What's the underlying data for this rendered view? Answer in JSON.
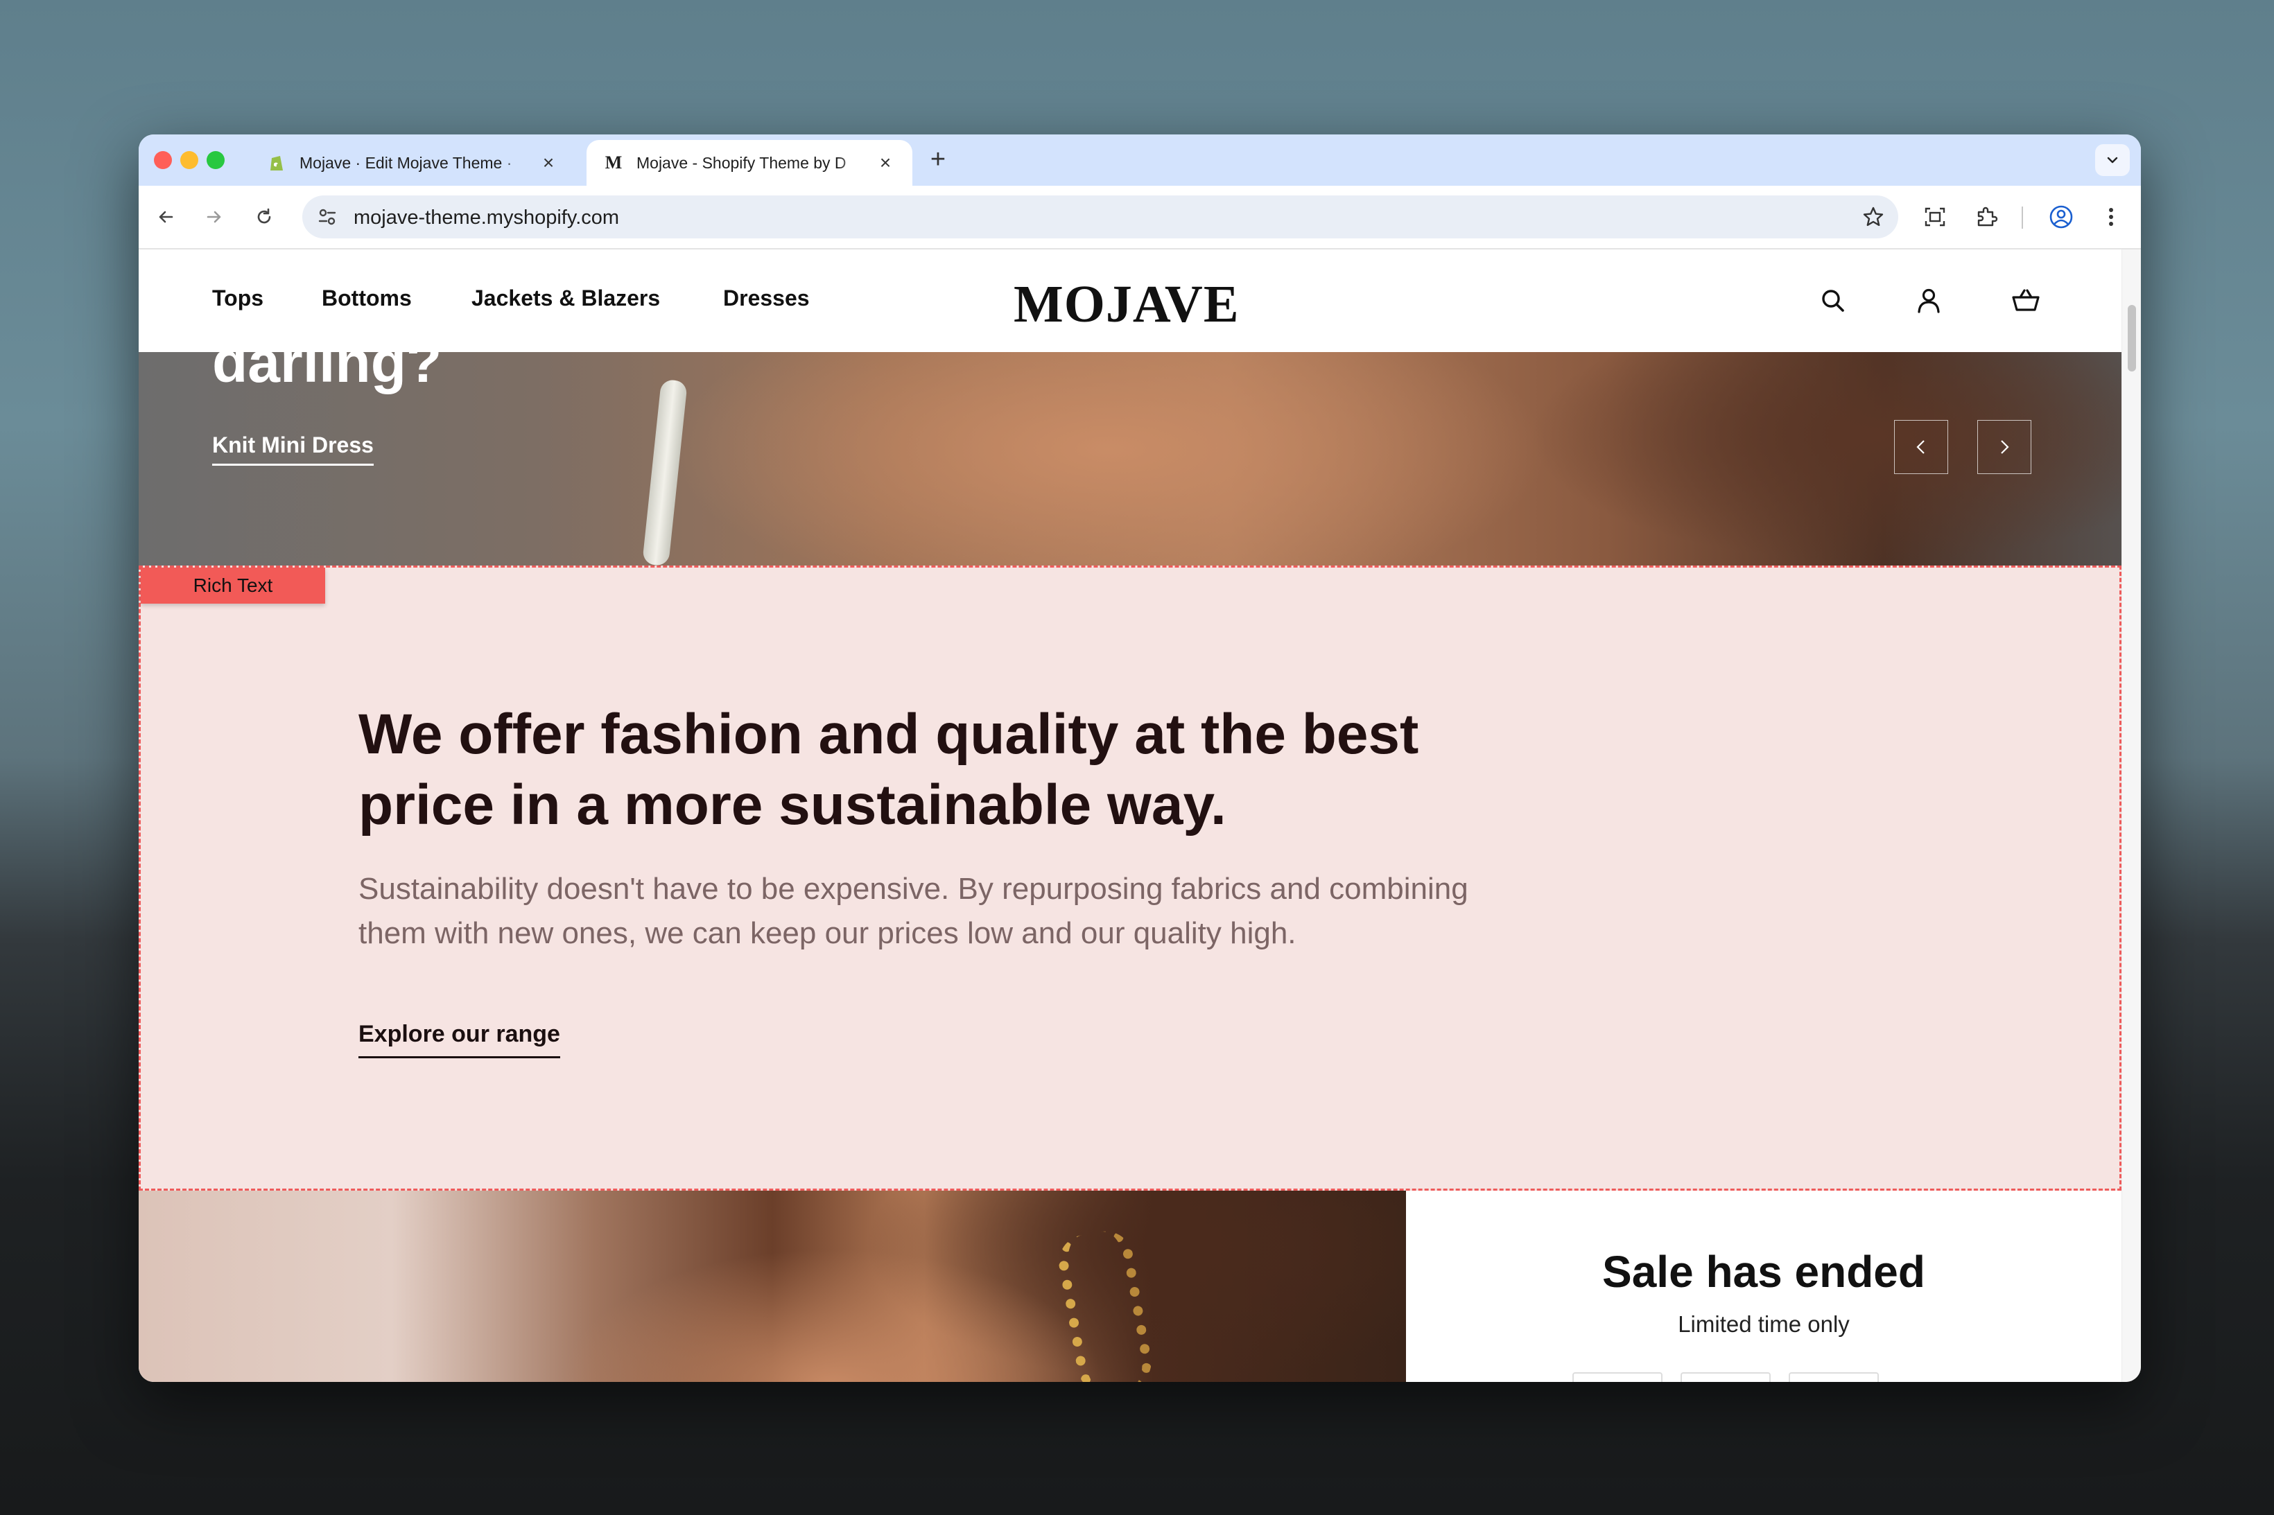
{
  "browser": {
    "tabs": [
      {
        "title": "Mojave · Edit Mojave Theme ·",
        "favicon": "shopify-icon",
        "active": false
      },
      {
        "title": "Mojave - Shopify Theme by D",
        "favicon": "M",
        "active": true
      }
    ],
    "url": "mojave-theme.myshopify.com",
    "colors": {
      "tabbar": "#d3e3fd",
      "omnibox": "#e9eef6",
      "close": "#ff5f57",
      "minimize": "#febc2e",
      "zoom": "#28c840"
    }
  },
  "site": {
    "logo": "MOJAVE",
    "nav": [
      "Tops",
      "Bottoms",
      "Jackets & Blazers",
      "Dresses"
    ],
    "header_icons": [
      "search-icon",
      "account-icon",
      "cart-icon"
    ]
  },
  "hero": {
    "heading_fragment": "darling?",
    "cta": "Knit Mini Dress"
  },
  "rich_text": {
    "section_label": "Rich Text",
    "heading": "We offer fashion and quality  at the best price in a more sustainable way.",
    "body": "Sustainability doesn't have to be expensive. By repurposing fabrics and combining them with new ones, we can keep our prices low and our quality high.",
    "link": "Explore our range",
    "colors": {
      "background": "#f6e4e2",
      "outline": "#ee5b5b",
      "heading": "#221011",
      "body": "#7c6565"
    }
  },
  "sale": {
    "title": "Sale has ended",
    "subtitle": "Limited time only"
  }
}
